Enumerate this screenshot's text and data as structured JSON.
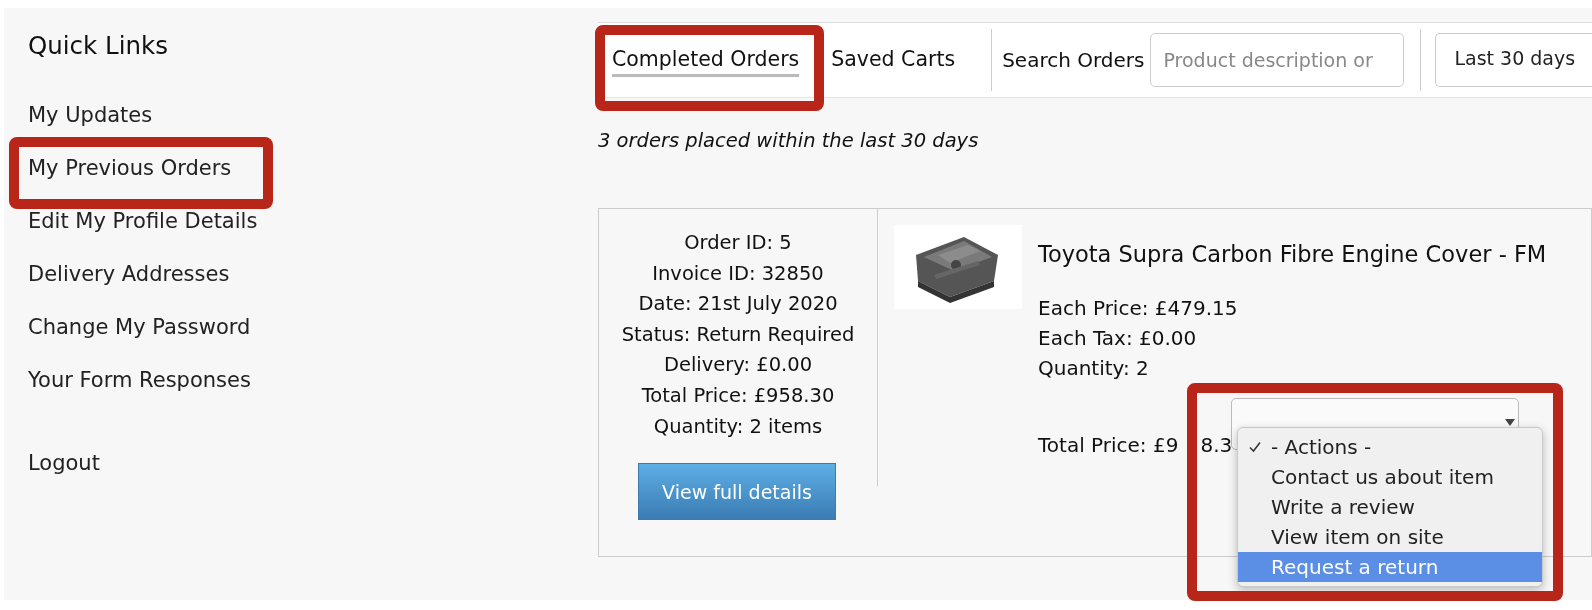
{
  "sidebar": {
    "title": "Quick Links",
    "items": [
      {
        "label": "My Updates"
      },
      {
        "label": "My Previous Orders"
      },
      {
        "label": "Edit My Profile Details"
      },
      {
        "label": "Delivery Addresses"
      },
      {
        "label": "Change My Password"
      },
      {
        "label": "Your Form Responses"
      }
    ],
    "logout": "Logout"
  },
  "tabs": [
    {
      "label": "Completed Orders",
      "selected": true
    },
    {
      "label": "Saved Carts",
      "selected": false
    }
  ],
  "search": {
    "label": "Search Orders",
    "placeholder": "Product description or"
  },
  "date_filter": {
    "value": "Last 30 days"
  },
  "summary": "3 orders placed within the last 30 days",
  "order": {
    "details": [
      "Order ID: 5",
      "Invoice ID: 32850",
      "Date: 21st July 2020",
      "Status: Return Required",
      "Delivery: £0.00",
      "Total Price: £958.30",
      "Quantity: 2 items"
    ],
    "button": "View full details",
    "item": {
      "title": "Toyota Supra Carbon Fibre Engine Cover - FM",
      "lines": [
        "Each Price: £479.15",
        "Each Tax: £0.00",
        "Quantity: 2"
      ],
      "total_parts": [
        "Total Price: £9",
        "8.3"
      ]
    }
  },
  "actions_menu": {
    "options": [
      {
        "label": "- Actions -",
        "checked": true,
        "selected": false
      },
      {
        "label": "Contact us about item",
        "checked": false,
        "selected": false
      },
      {
        "label": "Write a review",
        "checked": false,
        "selected": false
      },
      {
        "label": "View item on site",
        "checked": false,
        "selected": false
      },
      {
        "label": "Request a return",
        "checked": false,
        "selected": true
      }
    ]
  }
}
